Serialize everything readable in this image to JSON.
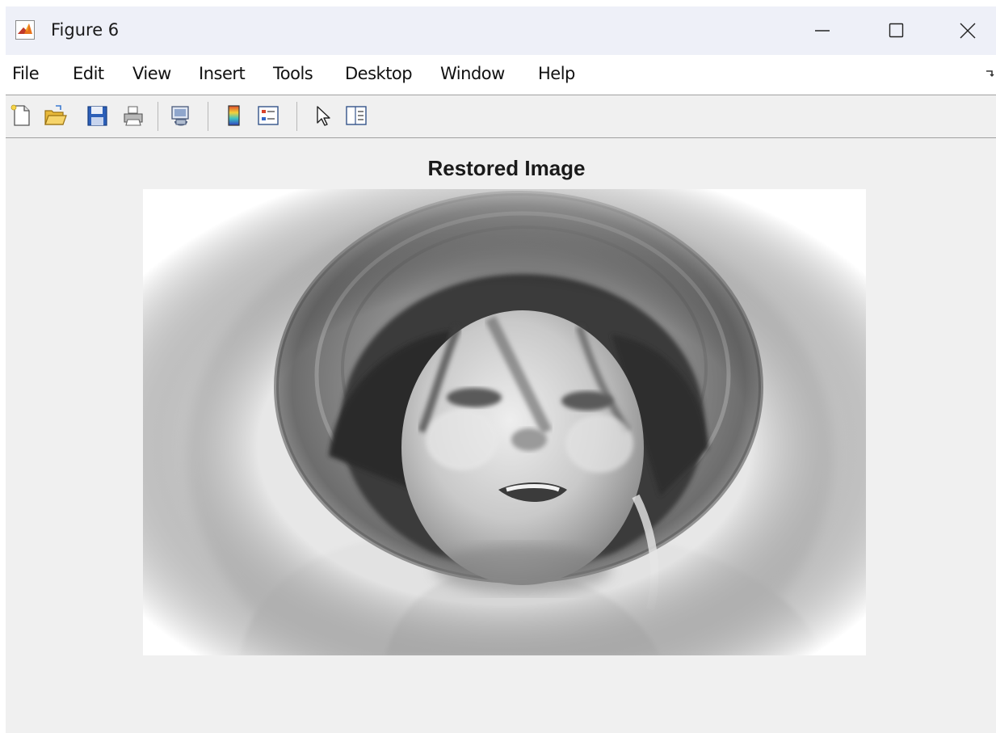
{
  "window": {
    "title": "Figure 6",
    "icon": "matlab-icon",
    "controls": [
      "minimize-icon",
      "maximize-icon",
      "close-icon"
    ]
  },
  "menu": {
    "items": [
      "File",
      "Edit",
      "View",
      "Insert",
      "Tools",
      "Desktop",
      "Window",
      "Help"
    ]
  },
  "toolbar": {
    "buttons": [
      "new-figure-icon",
      "open-file-icon",
      "save-icon",
      "print-icon",
      "link-plot-icon",
      "insert-colorbar-icon",
      "insert-legend-icon",
      "edit-plot-icon",
      "property-inspector-icon"
    ]
  },
  "axes": {
    "title": "Restored Image",
    "image": {
      "description": "restored-grayscale-photo",
      "colormap": "gray"
    }
  },
  "colors": {
    "titlebar": "#eef0f8",
    "figure_background": "#f0f0f0",
    "menubar": "#ffffff"
  }
}
